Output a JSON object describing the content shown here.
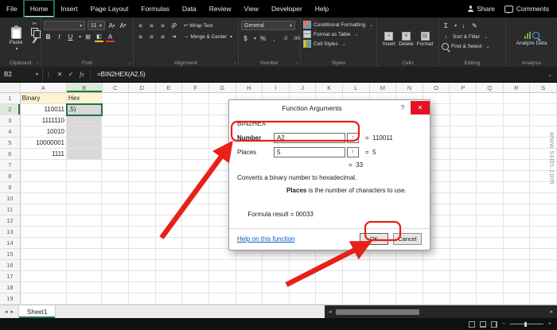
{
  "titlebar": {
    "tabs": [
      "File",
      "Home",
      "Insert",
      "Page Layout",
      "Formulas",
      "Data",
      "Review",
      "View",
      "Developer",
      "Help"
    ],
    "active": "Home",
    "share": "Share",
    "comments": "Comments"
  },
  "ribbon": {
    "clipboard": {
      "label": "Clipboard",
      "paste": "Paste"
    },
    "font": {
      "label": "Font",
      "size": "11"
    },
    "alignment": {
      "label": "Alignment",
      "wrap_text": "Wrap Text",
      "merge_center": "Merge & Center"
    },
    "number": {
      "label": "Number",
      "format": "General"
    },
    "styles": {
      "label": "Styles",
      "items": [
        "Conditional Formatting",
        "Format as Table",
        "Cell Styles"
      ]
    },
    "cells": {
      "label": "Cells",
      "items": [
        "Insert",
        "Delete",
        "Format"
      ]
    },
    "editing": {
      "label": "Editing",
      "items": [
        "Sort & Filter",
        "Find & Select"
      ]
    },
    "analysis": {
      "label": "Analysis",
      "button": "Analyze Data"
    }
  },
  "formula_bar": {
    "name_box": "B2",
    "formula": "=BIN2HEX(A2,5)"
  },
  "grid": {
    "col_letters": [
      "A",
      "B",
      "C",
      "D",
      "E",
      "F",
      "G",
      "H",
      "I",
      "J",
      "K",
      "L",
      "M",
      "N",
      "O",
      "P",
      "Q",
      "R",
      "S"
    ],
    "row_count": 19,
    "cells": [
      {
        "ref": "A1",
        "text": "Binary",
        "align": "left",
        "fill": "header"
      },
      {
        "ref": "B1",
        "text": "Hex",
        "align": "left",
        "fill": "header"
      },
      {
        "ref": "A2",
        "text": "110011",
        "align": "right"
      },
      {
        "ref": "A3",
        "text": "1111110",
        "align": "right"
      },
      {
        "ref": "A4",
        "text": "10010",
        "align": "right"
      },
      {
        "ref": "A5",
        "text": "10000001",
        "align": "right"
      },
      {
        "ref": "A6",
        "text": "1111",
        "align": "right"
      },
      {
        "ref": "B2",
        "text": ",5)",
        "align": "left"
      }
    ],
    "gray_cells": [
      "B2",
      "B3",
      "B4",
      "B5",
      "B6"
    ],
    "active_cell": "B2",
    "active_col": "B",
    "active_row": 2
  },
  "dialog": {
    "title": "Function Arguments",
    "function_name": "BIN2HEX",
    "args": [
      {
        "label": "Number",
        "value": "A2",
        "result": "=  110011"
      },
      {
        "label": "Places",
        "value": "5",
        "result": "=  5"
      }
    ],
    "result": "=  33",
    "description": "Converts a binary number to hexadecimal.",
    "arg_help_term": "Places",
    "arg_help_text": " is the number of characters to use.",
    "formula_result_label": "Formula result = ",
    "formula_result_value": "00033",
    "help_link": "Help on this function",
    "ok": "OK",
    "cancel": "Cancel"
  },
  "sheet_tabs": {
    "active": "Sheet1"
  },
  "watermark": "www.sxdn.com",
  "colors": {
    "annotation_red": "#e8201a",
    "selection_green": "#217346",
    "close_red": "#e81123",
    "header_fill": "#fff3cf"
  },
  "icons": {
    "chevron_down": "▾",
    "chevron_small": "⌄",
    "cut": "✂",
    "check": "✓",
    "x": "✕",
    "fx": "fx",
    "sigma": "Σ",
    "dots": "⋮",
    "nav_left": "◂",
    "nav_right": "▸",
    "collapse": "↑",
    "help": "?",
    "minus": "−",
    "plus": "+",
    "bold": "B",
    "italic": "I",
    "underline": "U",
    "borders": "⊞",
    "align": "≡",
    "merge": "⇔",
    "dollar": "$",
    "percent": "%",
    "comma": ",",
    "dec0": ".0",
    "dec00": ".00",
    "arrow_down": "↓",
    "pencil": "✎",
    "sort": "↕",
    "wrap": "↩",
    "launcher": "⌟"
  }
}
